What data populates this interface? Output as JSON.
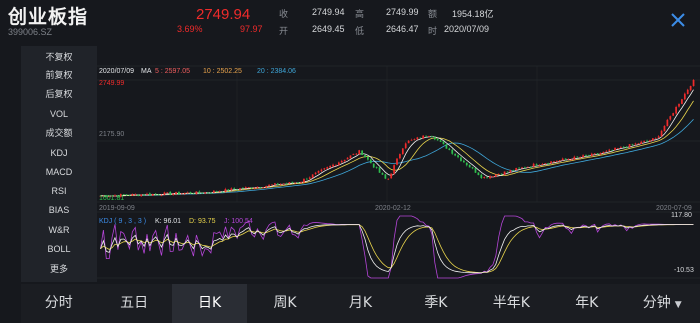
{
  "header": {
    "title": "创业板指",
    "code": "399006.SZ",
    "price": "2749.94",
    "change_pct": "3.69%",
    "change_abs": "97.97",
    "stats": {
      "close_label": "收",
      "close": "2749.94",
      "high_label": "高",
      "high": "2749.99",
      "amount_label": "额",
      "amount": "1954.18亿",
      "open_label": "开",
      "open": "2649.45",
      "low_label": "低",
      "low": "2646.47",
      "time_label": "时",
      "time": "2020/07/09"
    }
  },
  "left_menu": [
    {
      "label": "不复权",
      "style": "blue"
    },
    {
      "label": "前复权",
      "style": "muted"
    },
    {
      "label": "后复权",
      "style": "muted"
    },
    {
      "label": "VOL",
      "style": "normal"
    },
    {
      "label": "成交额",
      "style": "normal"
    },
    {
      "label": "KDJ",
      "style": "blue"
    },
    {
      "label": "MACD",
      "style": "normal"
    },
    {
      "label": "RSI",
      "style": "normal"
    },
    {
      "label": "BIAS",
      "style": "normal"
    },
    {
      "label": "W&R",
      "style": "normal"
    },
    {
      "label": "BOLL",
      "style": "normal"
    },
    {
      "label": "更多",
      "style": "normal"
    }
  ],
  "chart": {
    "date": "2020/07/09",
    "ma_label": "MA",
    "ma5": "5 : 2597.05",
    "ma10": "10 : 2502.25",
    "ma20": "20 : 2384.06",
    "max_price": "2749.99",
    "mid_price": "2175.90",
    "min_price": "1601.81",
    "x_start": "2019-09-09",
    "x_mid": "2020-02-12",
    "x_end": "2020-07-09",
    "kdj_label": "KDJ ( 9 , 3 , 3 )",
    "kdj_k": "K: 96.01",
    "kdj_d": "D: 93.75",
    "kdj_j": "J: 100.54",
    "kdj_max": "117.80",
    "kdj_min": "-10.53"
  },
  "colors": {
    "up": "#ef2b2b",
    "down": "#2fbf4e",
    "ma5": "#f0f0f0",
    "ma10": "#e8d44c",
    "ma20": "#3ea6d8",
    "kdj_k": "#f0f0f0",
    "kdj_d": "#e8d44c",
    "kdj_j": "#b545d8"
  },
  "tabs": [
    {
      "label": "分时",
      "active": false
    },
    {
      "label": "五日",
      "active": false
    },
    {
      "label": "日K",
      "active": true
    },
    {
      "label": "周K",
      "active": false
    },
    {
      "label": "月K",
      "active": false
    },
    {
      "label": "季K",
      "active": false
    },
    {
      "label": "半年K",
      "active": false
    },
    {
      "label": "年K",
      "active": false
    },
    {
      "label": "分钟",
      "active": false,
      "dropdown": true
    }
  ],
  "chart_data": {
    "type": "candlestick",
    "title": "",
    "x_range": [
      "2019-09-09",
      "2020-07-09"
    ],
    "y_range": [
      1601.81,
      2749.99
    ],
    "close_keypoints": [
      {
        "date": "2019-09-09",
        "close": 1660
      },
      {
        "date": "2019-11-01",
        "close": 1690
      },
      {
        "date": "2019-12-20",
        "close": 1790
      },
      {
        "date": "2020-01-20",
        "close": 2080
      },
      {
        "date": "2020-02-03",
        "close": 1800
      },
      {
        "date": "2020-02-12",
        "close": 2160
      },
      {
        "date": "2020-02-25",
        "close": 2240
      },
      {
        "date": "2020-03-23",
        "close": 1830
      },
      {
        "date": "2020-04-20",
        "close": 1960
      },
      {
        "date": "2020-05-20",
        "close": 2050
      },
      {
        "date": "2020-06-20",
        "close": 2200
      },
      {
        "date": "2020-07-09",
        "close": 2749.94
      }
    ],
    "indicator": {
      "name": "KDJ",
      "params": [
        9,
        3,
        3
      ],
      "k": 96.01,
      "d": 93.75,
      "j": 100.54,
      "range": [
        -10.53,
        117.8
      ]
    }
  }
}
